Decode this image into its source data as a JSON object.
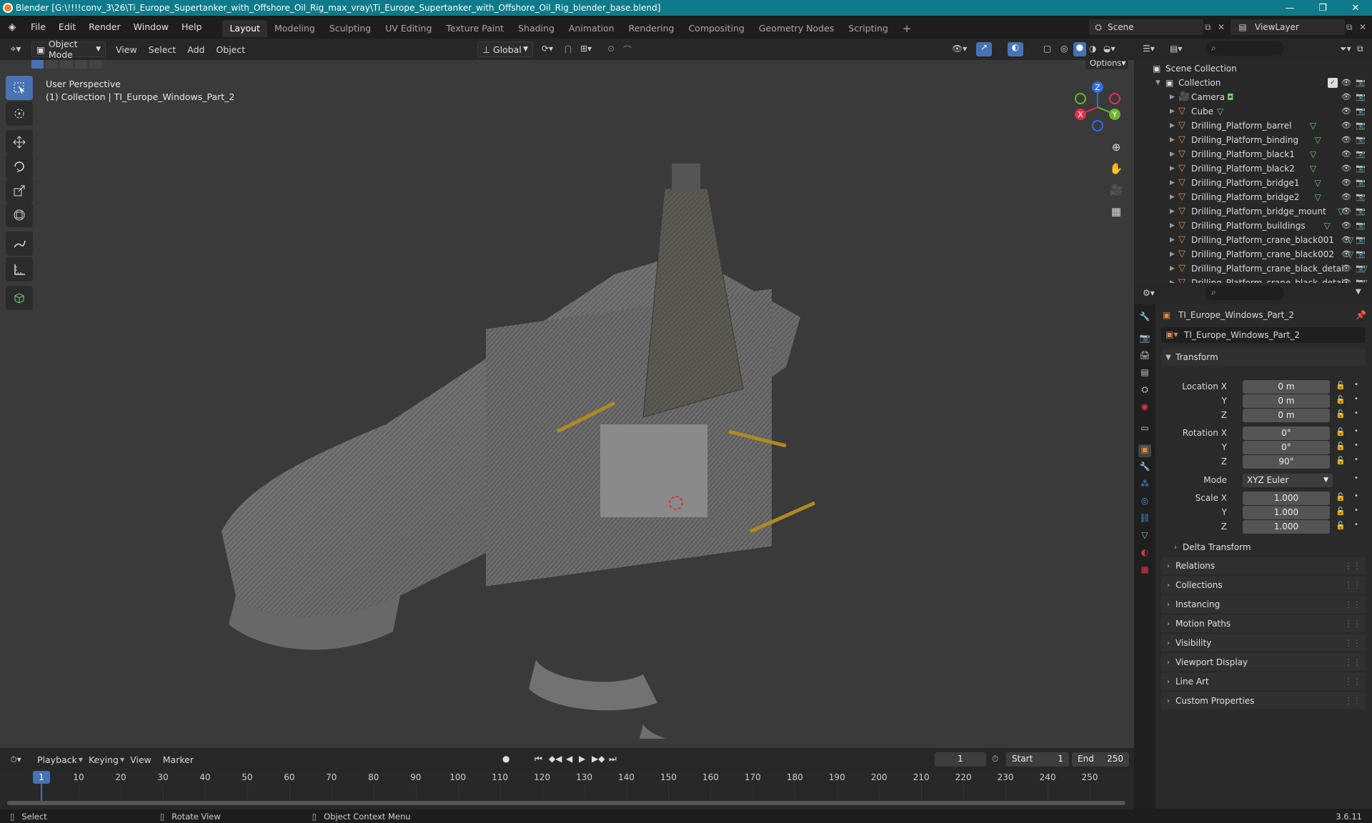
{
  "window": {
    "title": "Blender [G:\\!!!!conv_3\\26\\Ti_Europe_Supertanker_with_Offshore_Oil_Rig_max_vray\\Ti_Europe_Supertanker_with_Offshore_Oil_Rig_blender_base.blend]",
    "controls": [
      "—",
      "❐",
      "✕"
    ]
  },
  "menubar": {
    "menus": [
      "File",
      "Edit",
      "Render",
      "Window",
      "Help"
    ],
    "workspaces": [
      "Layout",
      "Modeling",
      "Sculpting",
      "UV Editing",
      "Texture Paint",
      "Shading",
      "Animation",
      "Rendering",
      "Compositing",
      "Geometry Nodes",
      "Scripting"
    ],
    "active_workspace": "Layout",
    "add_tab": "+",
    "scene_label": "Scene",
    "viewlayer_label": "ViewLayer"
  },
  "viewport_header": {
    "mode": "Object Mode",
    "menus": [
      "View",
      "Select",
      "Add",
      "Object"
    ],
    "orientation": "Global",
    "options_label": "Options"
  },
  "viewport": {
    "perspective_label": "User Perspective",
    "collection_label": "(1) Collection | TI_Europe_Windows_Part_2",
    "gizmo": {
      "x": "X",
      "y": "Y",
      "z": "Z"
    },
    "tools": [
      "select-box",
      "cursor",
      "move",
      "rotate",
      "scale",
      "transform",
      "annotate",
      "measure",
      "add-cube"
    ]
  },
  "outliner": {
    "root": "Scene Collection",
    "collection": "Collection",
    "items": [
      {
        "name": "Camera",
        "type": "camera"
      },
      {
        "name": "Cube",
        "type": "mesh"
      },
      {
        "name": "Drilling_Platform_barrel",
        "type": "mesh"
      },
      {
        "name": "Drilling_Platform_binding",
        "type": "mesh"
      },
      {
        "name": "Drilling_Platform_black1",
        "type": "mesh"
      },
      {
        "name": "Drilling_Platform_black2",
        "type": "mesh"
      },
      {
        "name": "Drilling_Platform_bridge1",
        "type": "mesh"
      },
      {
        "name": "Drilling_Platform_bridge2",
        "type": "mesh"
      },
      {
        "name": "Drilling_Platform_bridge_mount",
        "type": "mesh"
      },
      {
        "name": "Drilling_Platform_buildings",
        "type": "mesh"
      },
      {
        "name": "Drilling_Platform_crane_black001",
        "type": "mesh"
      },
      {
        "name": "Drilling_Platform_crane_black002",
        "type": "mesh"
      },
      {
        "name": "Drilling_Platform_crane_black_detai",
        "type": "mesh"
      },
      {
        "name": "Drilling_Platform_crane_black_detai",
        "type": "mesh"
      }
    ]
  },
  "properties": {
    "object_name": "TI_Europe_Windows_Part_2",
    "data_name": "TI_Europe_Windows_Part_2",
    "transform_label": "Transform",
    "location_label": "Location X",
    "location": [
      "0 m",
      "0 m",
      "0 m"
    ],
    "rotation_label": "Rotation X",
    "rotation": [
      "0°",
      "0°",
      "90°"
    ],
    "mode_label": "Mode",
    "mode_value": "XYZ Euler",
    "scale_label": "Scale X",
    "scale": [
      "1.000",
      "1.000",
      "1.000"
    ],
    "axis_y": "Y",
    "axis_z": "Z",
    "delta_transform": "Delta Transform",
    "panels": [
      "Relations",
      "Collections",
      "Instancing",
      "Motion Paths",
      "Visibility",
      "Viewport Display",
      "Line Art",
      "Custom Properties"
    ]
  },
  "timeline": {
    "menus": [
      "Playback",
      "Keying",
      "View",
      "Marker"
    ],
    "current_frame": "1",
    "start_label": "Start",
    "start": "1",
    "end_label": "End",
    "end": "250",
    "ticks": [
      "1",
      "10",
      "20",
      "30",
      "40",
      "50",
      "60",
      "70",
      "80",
      "90",
      "100",
      "110",
      "120",
      "130",
      "140",
      "150",
      "160",
      "170",
      "180",
      "190",
      "200",
      "210",
      "220",
      "230",
      "240",
      "250"
    ]
  },
  "statusbar": {
    "select": "Select",
    "rotate": "Rotate View",
    "context": "Object Context Menu",
    "version": "3.6.11"
  },
  "colors": {
    "accent": "#4772b3",
    "titlebar": "#0f7a8a",
    "mesh_icon": "#e08a3c",
    "x_axis": "#e0324a",
    "y_axis": "#6bb62b",
    "z_axis": "#2f6fe0"
  }
}
